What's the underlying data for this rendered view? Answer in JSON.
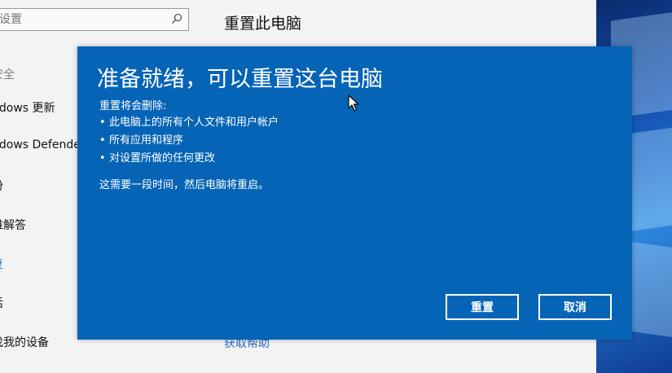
{
  "settings": {
    "search": {
      "placeholder": "设置"
    },
    "nav_items": [
      {
        "label": "安全",
        "style": "gray"
      },
      {
        "label": "ndows 更新",
        "style": "normal"
      },
      {
        "label": "ndows Defende",
        "style": "normal"
      },
      {
        "label": "份",
        "style": "normal"
      },
      {
        "label": "难解答",
        "style": "normal"
      },
      {
        "label": "复",
        "style": "active"
      },
      {
        "label": "活",
        "style": "normal"
      },
      {
        "label": "找我的设备",
        "style": "normal"
      }
    ],
    "page_title": "重置此电脑",
    "help_link": "获取帮助"
  },
  "dialog": {
    "title": "准备就绪，可以重置这台电脑",
    "subtitle": "重置将会删除:",
    "bullet_char": "•",
    "items": [
      "此电脑上的所有个人文件和用户帐户",
      "所有应用和程序",
      "对设置所做的任何更改"
    ],
    "note": "这需要一段时间，然后电脑将重启。",
    "reset_button": "重置",
    "cancel_button": "取消"
  },
  "colors": {
    "dialog_bg": "#0664b6",
    "accent_link": "#2a6bc4",
    "active_nav": "#0a63c6"
  }
}
